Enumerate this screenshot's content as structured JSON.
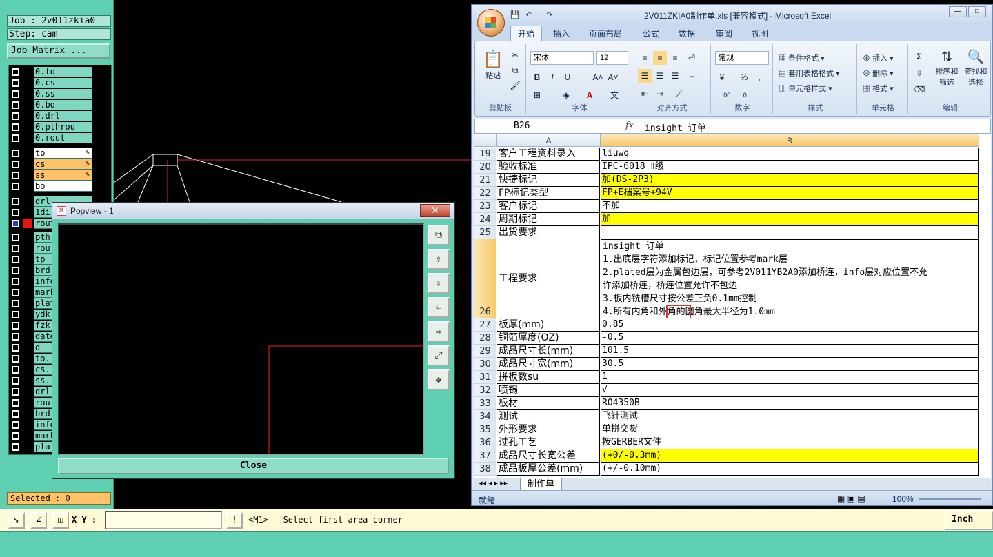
{
  "cam": {
    "job": "Job : 2v011zkia0",
    "step": "Step: cam",
    "job_matrix": "Job Matrix ...",
    "layers_top": [
      "0.to",
      "0.cs",
      "0.ss",
      "0.bo",
      "0.drl",
      "0.pthrou",
      "0.rout"
    ],
    "layers_board": [
      {
        "name": "to",
        "style": "board"
      },
      {
        "name": "cs",
        "style": "orange"
      },
      {
        "name": "ss",
        "style": "orange"
      },
      {
        "name": "bo",
        "style": "board"
      }
    ],
    "layers_mid": [
      "drl",
      "1di",
      "rout"
    ],
    "layers_rest": [
      "pth",
      "rou",
      "tp",
      "brd",
      "info",
      "mark",
      "plat",
      "ydk",
      "fzk",
      "date",
      "d",
      "to.",
      "cs.",
      "ss.",
      "drl",
      "rout",
      "brd",
      "info",
      "mark",
      "plat"
    ],
    "selected": "Selected : 0",
    "xy_label": "X Y :",
    "xy_value": "",
    "hint": "<M1> - Select first area corner",
    "units": "Inch",
    "colors": {
      "accent": "#5fcfb1",
      "orange": "#ffc266",
      "board": "#ffffff"
    }
  },
  "popview": {
    "title": "Popview - 1",
    "close_x": "✕",
    "close_label": "Close",
    "side_buttons": [
      "zoom-window-icon",
      "pan-up-icon",
      "pan-down-icon",
      "pan-left-icon",
      "pan-right-icon",
      "fit-icon",
      "zoom-home-icon"
    ]
  },
  "excel": {
    "title": "2V011ZKIA0制作单.xls  [兼容模式] - Microsoft Excel",
    "tabs": [
      "开始",
      "插入",
      "页面布局",
      "公式",
      "数据",
      "审阅",
      "视图"
    ],
    "ribbon": {
      "clipboard": {
        "paste": "粘贴",
        "label": "剪贴板"
      },
      "font": {
        "name": "宋体",
        "size": "12",
        "label": "字体"
      },
      "alignment": {
        "label": "对齐方式"
      },
      "number": {
        "format": "常规",
        "label": "数字"
      },
      "styles": {
        "cond": "条件格式",
        "table": "套用表格格式",
        "cell": "单元格样式",
        "label": "样式"
      },
      "cells": {
        "insert": "插入",
        "delete": "删除",
        "format": "格式",
        "label": "单元格"
      },
      "editing": {
        "sort": "排序和",
        "sort2": "筛选",
        "find": "查找和",
        "find2": "选择",
        "label": "编辑"
      }
    },
    "name_box": "B26",
    "formula": "insight 订单",
    "columns": [
      "A",
      "B"
    ],
    "rows": [
      {
        "n": "19",
        "a": "客户工程资料录入",
        "b": "liuwq",
        "yellow": false
      },
      {
        "n": "20",
        "a": "验收标准",
        "b": "IPC-6018 Ⅱ级",
        "yellow": false
      },
      {
        "n": "21",
        "a": "快捷标记",
        "b": "加(DS-2P3)",
        "yellow": true
      },
      {
        "n": "22",
        "a": "FP标记类型",
        "b": "FP+E档案号+94V",
        "yellow": true
      },
      {
        "n": "23",
        "a": "客户标记",
        "b": "不加",
        "yellow": false
      },
      {
        "n": "24",
        "a": "周期标记",
        "b": "加",
        "yellow": true
      },
      {
        "n": "25",
        "a": "出货要求",
        "b": "",
        "yellow": false
      }
    ],
    "row26": {
      "n": "26",
      "a": "工程要求",
      "lines": [
        "insight 订单",
        "1.出底层字符添加标记，标记位置参考mark层",
        "2.plated层为金属包边层，可参考2V011YB2A0添加桥连，info层对应位置不允",
        "许添加桥连，桥连位置允许不包边",
        "3.板内铣槽尺寸按公差正负0.1mm控制",
        "4.所有内角和外角的圆角最大半径为1.0mm"
      ]
    },
    "rows2": [
      {
        "n": "27",
        "a": "板厚(mm)",
        "b": "0.85",
        "yellow": false
      },
      {
        "n": "28",
        "a": "铜箔厚度(OZ)",
        "b": "-0.5",
        "yellow": false
      },
      {
        "n": "29",
        "a": "成品尺寸长(mm)",
        "b": "101.5",
        "yellow": false
      },
      {
        "n": "30",
        "a": "成品尺寸宽(mm)",
        "b": "30.5",
        "yellow": false
      },
      {
        "n": "31",
        "a": "拼板数su",
        "b": "1",
        "yellow": false
      },
      {
        "n": "32",
        "a": "喷锡",
        "b": "√",
        "yellow": false
      },
      {
        "n": "33",
        "a": "板材",
        "b": "RO4350B",
        "yellow": false
      },
      {
        "n": "34",
        "a": "测试",
        "b": "飞针测试",
        "yellow": false
      },
      {
        "n": "35",
        "a": "外形要求",
        "b": "单拼交货",
        "yellow": false
      },
      {
        "n": "36",
        "a": "过孔工艺",
        "b": "按GERBER文件",
        "yellow": false
      },
      {
        "n": "37",
        "a": "成品尺寸长宽公差",
        "b": "(+0/-0.3mm)",
        "yellow": true
      },
      {
        "n": "38",
        "a": "成品板厚公差(mm)",
        "b": "(+/-0.10mm)",
        "yellow": false
      }
    ],
    "sheet_tab": "制作单",
    "status": "就绪",
    "zoom": "100%"
  }
}
